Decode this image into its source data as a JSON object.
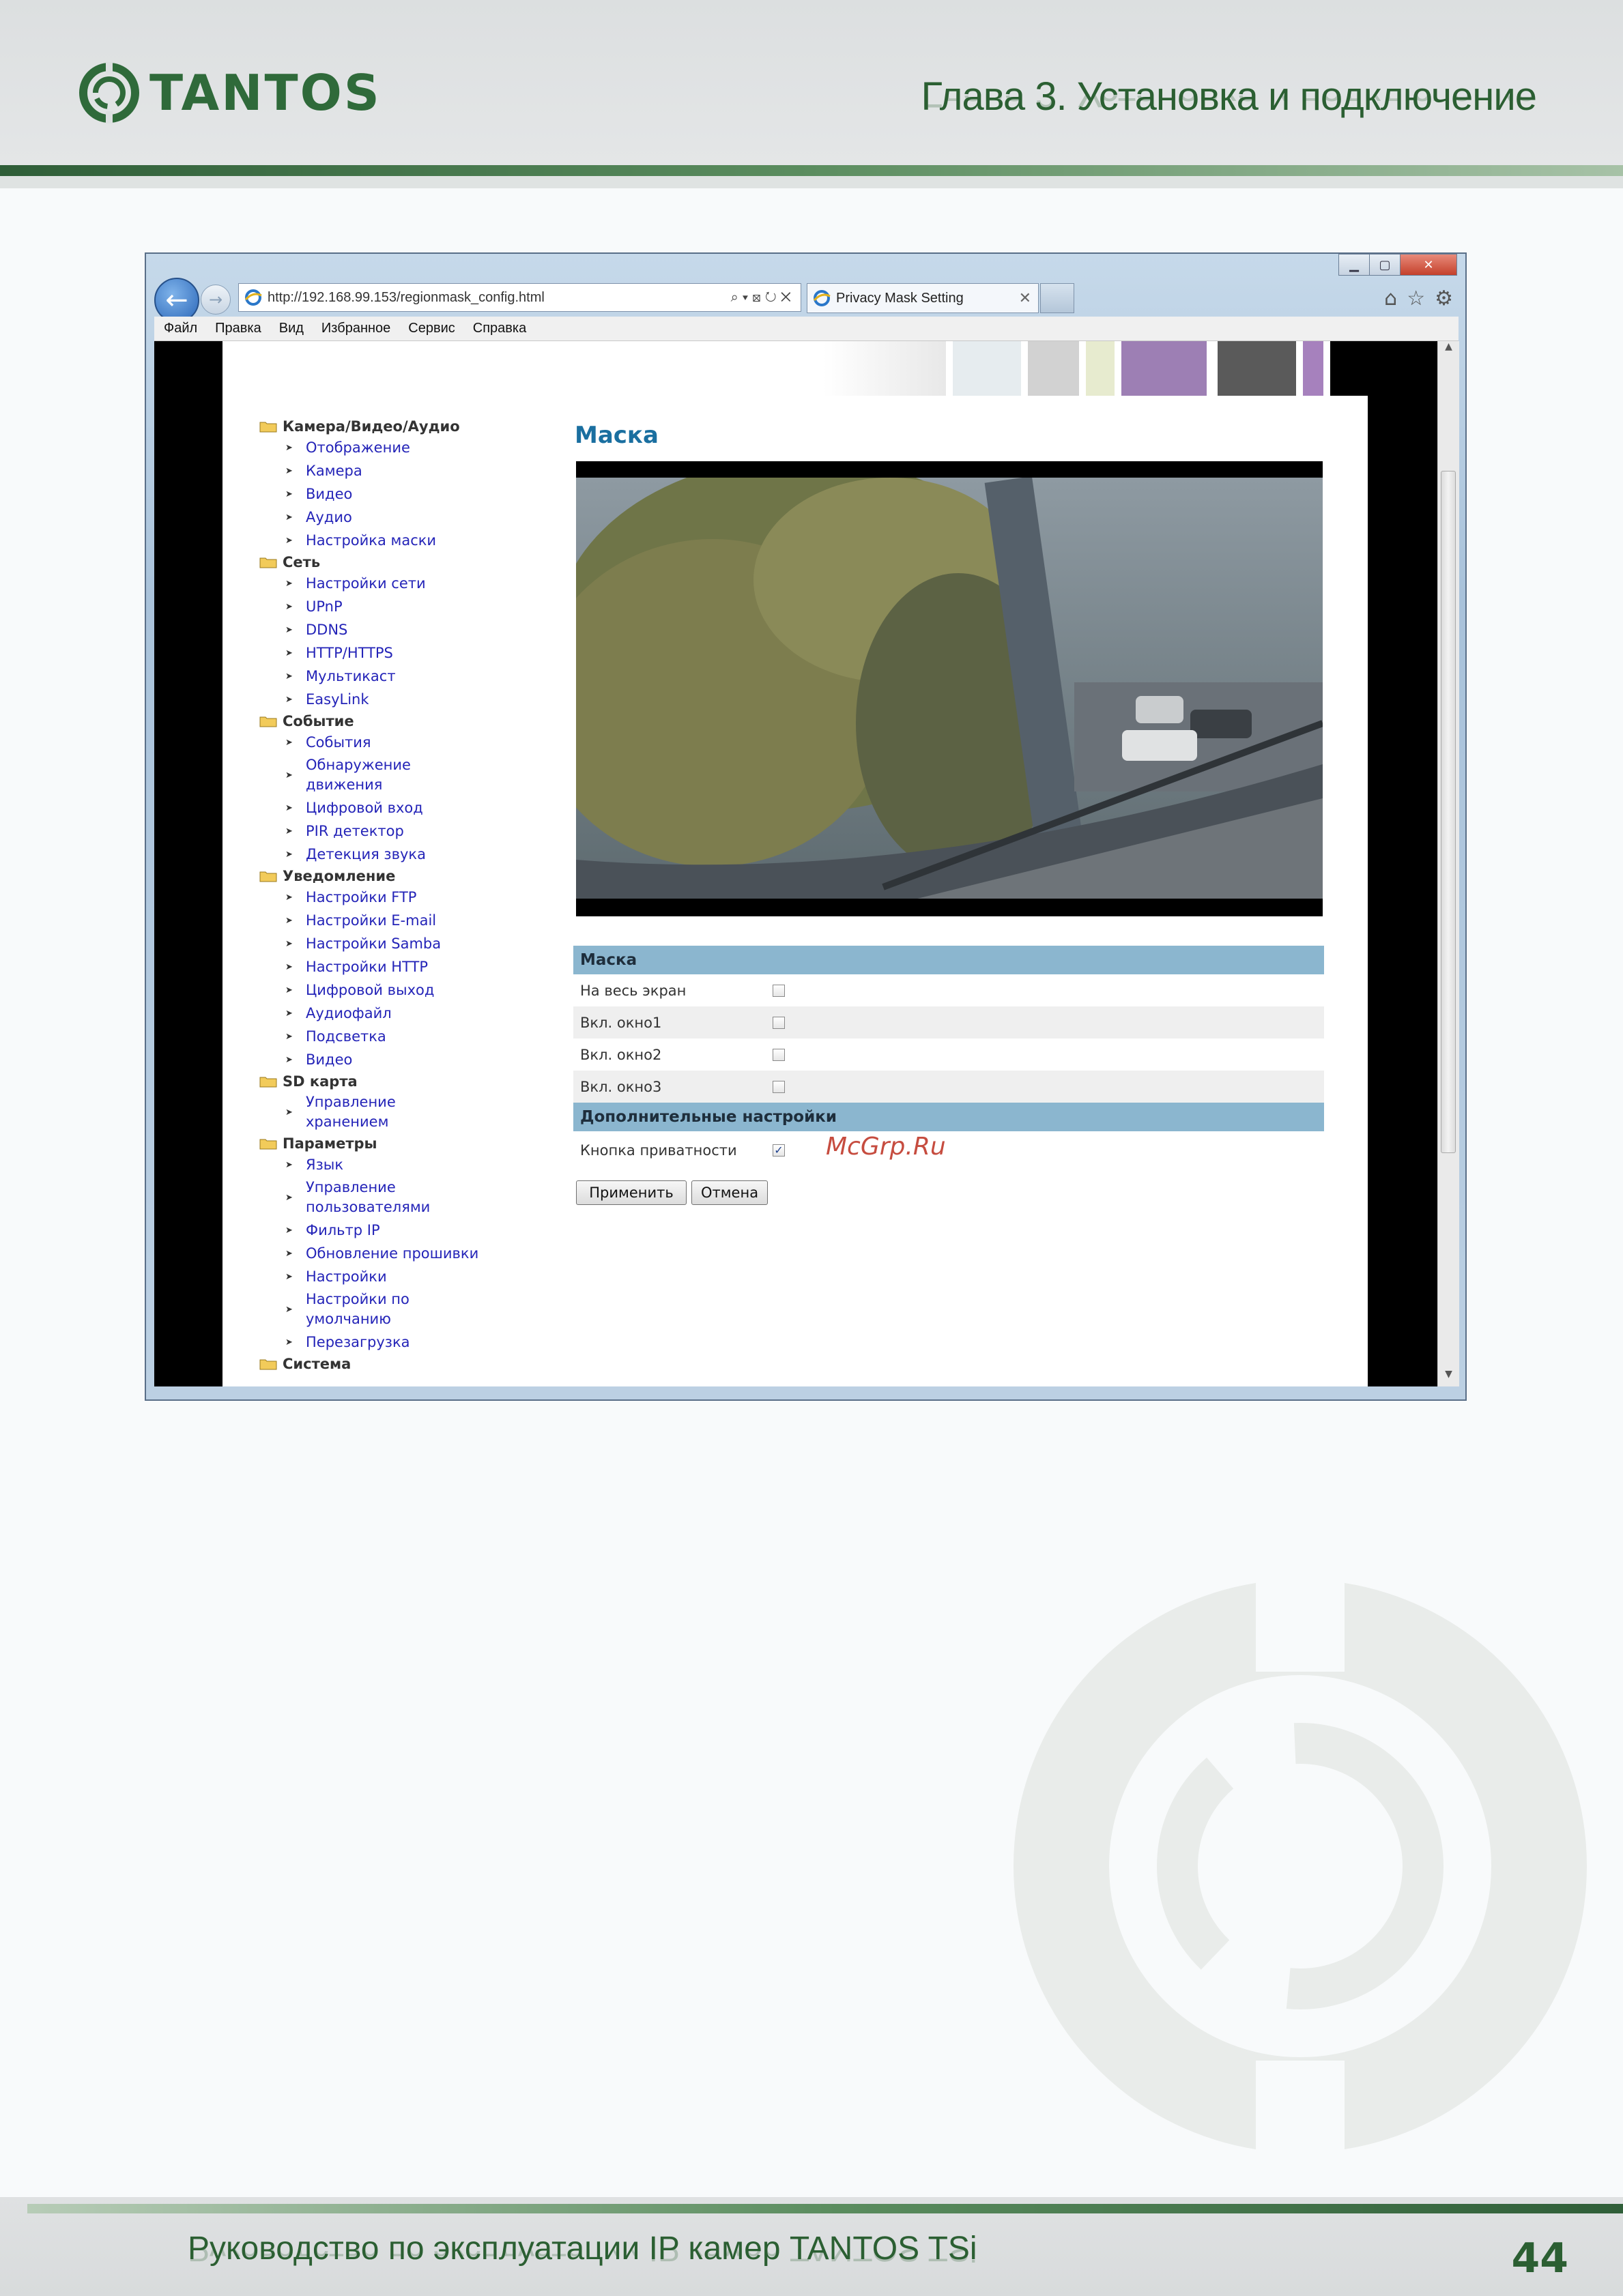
{
  "header": {
    "logo_text": "TANTOS",
    "chapter_title": "Глава 3. Установка и подключение"
  },
  "browser": {
    "url": "http://192.168.99.153/regionmask_config.html",
    "tab_title": "Privacy Mask Setting",
    "menu": [
      "Файл",
      "Правка",
      "Вид",
      "Избранное",
      "Сервис",
      "Справка"
    ]
  },
  "sidebar": [
    {
      "category": "Камера/Видео/Аудио",
      "items": [
        "Отображение",
        "Камера",
        "Видео",
        "Аудио",
        "Настройка маски"
      ]
    },
    {
      "category": "Сеть",
      "items": [
        "Настройки сети",
        "UPnP",
        "DDNS",
        "HTTP/HTTPS",
        "Мультикаст",
        "EasyLink"
      ]
    },
    {
      "category": "Событие",
      "items": [
        "События",
        "Обнаружение движения",
        "Цифровой вход",
        "PIR детектор",
        "Детекция звука"
      ]
    },
    {
      "category": "Уведомление",
      "items": [
        "Настройки FTP",
        "Настройки E-mail",
        "Настройки Samba",
        "Настройки HTTP",
        "Цифровой выход",
        "Аудиофайл",
        "Подсветка",
        "Видео"
      ]
    },
    {
      "category": "SD карта",
      "items": [
        "Управление хранением"
      ]
    },
    {
      "category": "Параметры",
      "items": [
        "Язык",
        "Управление пользователями",
        "Фильтр IP",
        "Обновление прошивки",
        "Настройки",
        "Настройки по умолчанию",
        "Перезагрузка"
      ]
    },
    {
      "category": "Система",
      "items": []
    }
  ],
  "main": {
    "title": "Маска",
    "section_mask": "Маска",
    "rows": [
      {
        "label": "На весь экран",
        "checked": false
      },
      {
        "label": "Вкл. окно1",
        "checked": false
      },
      {
        "label": "Вкл. окно2",
        "checked": false
      },
      {
        "label": "Вкл. окно3",
        "checked": false
      }
    ],
    "section_extra": "Дополнительные настройки",
    "privacy_label": "Кнопка приватности",
    "privacy_checked": true,
    "apply": "Применить",
    "cancel": "Отмена"
  },
  "watermark_text": "McGrp.Ru",
  "footer": {
    "text": "Руководство по эксплуатации IP камер TANTOS TSi",
    "page": "44"
  },
  "colors": {
    "brand_green": "#2f6a3a",
    "section_header": "#8bb6cf",
    "link": "#2424b8",
    "title_blue": "#1a6fa0"
  }
}
